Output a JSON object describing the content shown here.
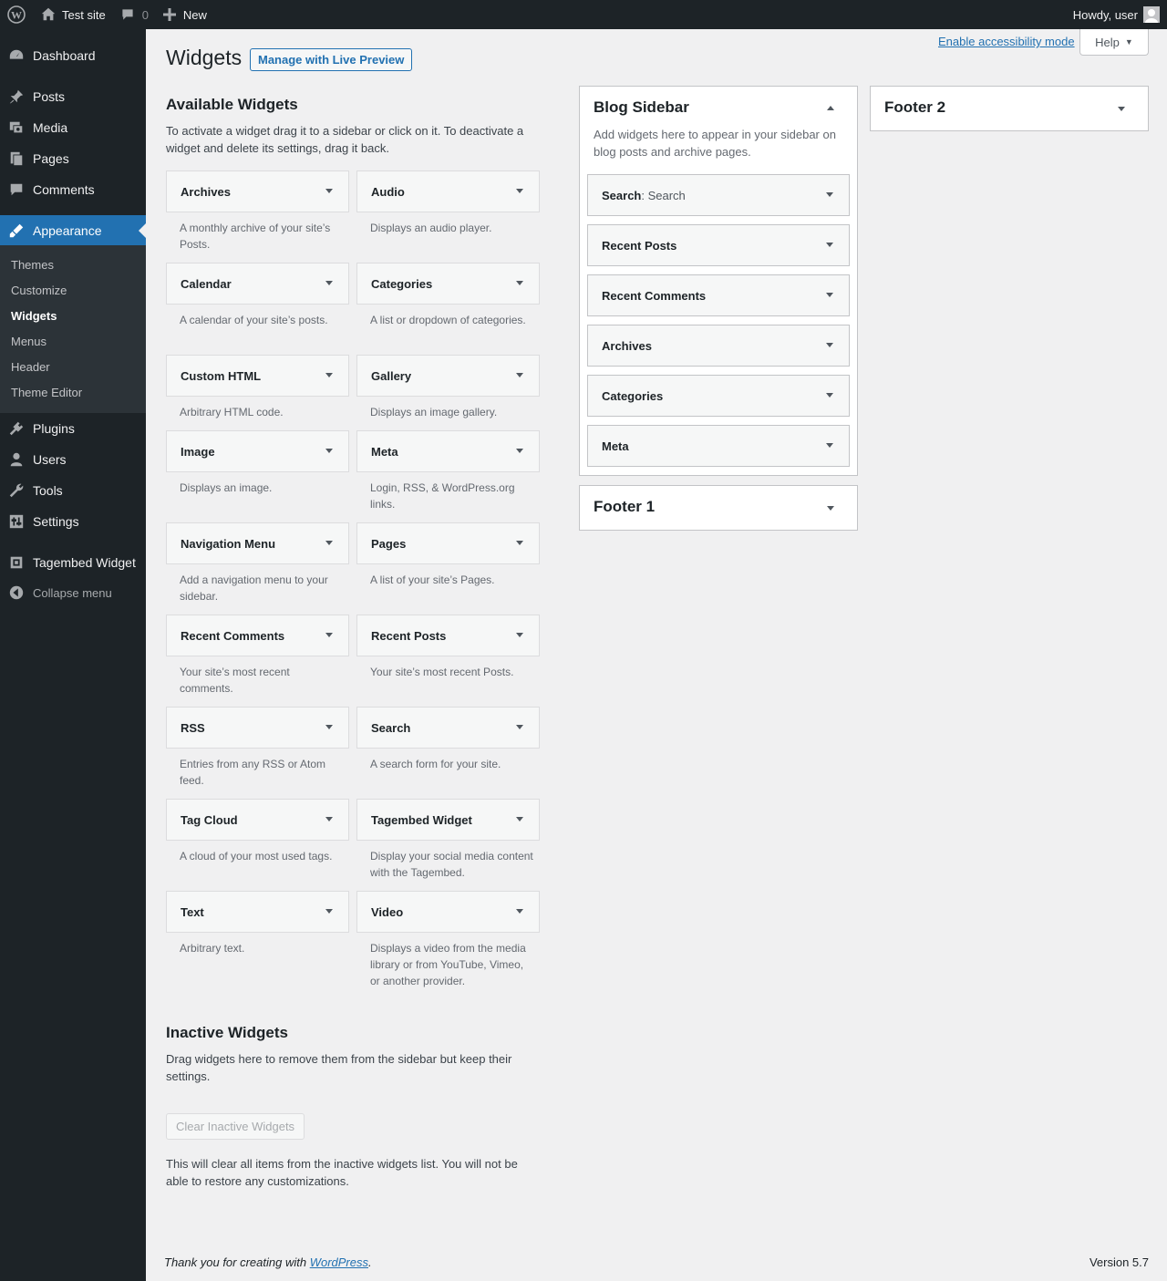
{
  "adminbar": {
    "site_name": "Test site",
    "comments_count": "0",
    "new_label": "New",
    "howdy": "Howdy, user"
  },
  "menu": {
    "dashboard": "Dashboard",
    "posts": "Posts",
    "media": "Media",
    "pages": "Pages",
    "comments": "Comments",
    "appearance": "Appearance",
    "plugins": "Plugins",
    "users": "Users",
    "tools": "Tools",
    "settings": "Settings",
    "tagembed": "Tagembed Widget",
    "collapse": "Collapse menu",
    "submenu": [
      "Themes",
      "Customize",
      "Widgets",
      "Menus",
      "Header",
      "Theme Editor"
    ]
  },
  "page": {
    "title": "Widgets",
    "live_preview": "Manage with Live Preview",
    "a11y": "Enable accessibility mode",
    "help": "Help"
  },
  "available": {
    "title": "Available Widgets",
    "description": "To activate a widget drag it to a sidebar or click on it. To deactivate a widget and delete its settings, drag it back.",
    "widgets": [
      {
        "name": "Archives",
        "desc": "A monthly archive of your site’s Posts."
      },
      {
        "name": "Audio",
        "desc": "Displays an audio player."
      },
      {
        "name": "Calendar",
        "desc": "A calendar of your site’s posts."
      },
      {
        "name": "Categories",
        "desc": "A list or dropdown of categories."
      },
      {
        "name": "Custom HTML",
        "desc": "Arbitrary HTML code."
      },
      {
        "name": "Gallery",
        "desc": "Displays an image gallery."
      },
      {
        "name": "Image",
        "desc": "Displays an image."
      },
      {
        "name": "Meta",
        "desc": "Login, RSS, & WordPress.org links."
      },
      {
        "name": "Navigation Menu",
        "desc": "Add a navigation menu to your sidebar."
      },
      {
        "name": "Pages",
        "desc": "A list of your site’s Pages."
      },
      {
        "name": "Recent Comments",
        "desc": "Your site’s most recent comments."
      },
      {
        "name": "Recent Posts",
        "desc": "Your site’s most recent Posts."
      },
      {
        "name": "RSS",
        "desc": "Entries from any RSS or Atom feed."
      },
      {
        "name": "Search",
        "desc": "A search form for your site."
      },
      {
        "name": "Tag Cloud",
        "desc": "A cloud of your most used tags."
      },
      {
        "name": "Tagembed Widget",
        "desc": "Display your social media content with the Tagembed."
      },
      {
        "name": "Text",
        "desc": "Arbitrary text."
      },
      {
        "name": "Video",
        "desc": "Displays a video from the media library or from YouTube, Vimeo, or another provider."
      }
    ]
  },
  "inactive": {
    "title": "Inactive Widgets",
    "description": "Drag widgets here to remove them from the sidebar but keep their settings.",
    "clear_button": "Clear Inactive Widgets",
    "note": "This will clear all items from the inactive widgets list. You will not be able to restore any customizations."
  },
  "blog_sidebar": {
    "title": "Blog Sidebar",
    "description": "Add widgets here to appear in your sidebar on blog posts and archive pages.",
    "widgets": [
      {
        "name": "Search",
        "title": ": Search"
      },
      {
        "name": "Recent Posts",
        "title": ""
      },
      {
        "name": "Recent Comments",
        "title": ""
      },
      {
        "name": "Archives",
        "title": ""
      },
      {
        "name": "Categories",
        "title": ""
      },
      {
        "name": "Meta",
        "title": ""
      }
    ]
  },
  "footer1": {
    "title": "Footer 1"
  },
  "footer2": {
    "title": "Footer 2"
  },
  "footer": {
    "thanks": "Thank you for creating with ",
    "wp_link": "WordPress",
    "period": ".",
    "version": "Version 5.7"
  }
}
